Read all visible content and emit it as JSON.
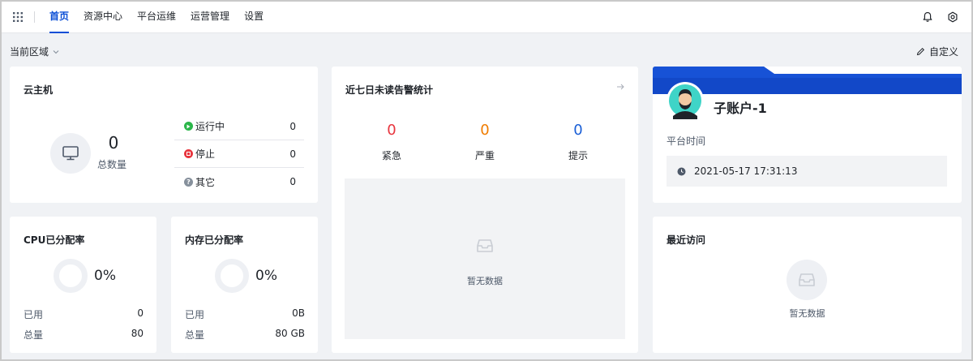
{
  "nav": {
    "items": [
      {
        "label": "首页",
        "active": true
      },
      {
        "label": "资源中心",
        "active": false
      },
      {
        "label": "平台运维",
        "active": false
      },
      {
        "label": "运营管理",
        "active": false
      },
      {
        "label": "设置",
        "active": false
      }
    ]
  },
  "icons": {
    "apps": "grid-icon",
    "notifications": "bell-icon",
    "settings": "gear-icon"
  },
  "toolbar": {
    "region_label": "当前区域",
    "customize_label": "自定义"
  },
  "host": {
    "title": "云主机",
    "total": "0",
    "total_label": "总数量",
    "statuses": [
      {
        "label": "运行中",
        "value": "0",
        "color": "#2bb64a"
      },
      {
        "label": "停止",
        "value": "0",
        "color": "#e8353e"
      },
      {
        "label": "其它",
        "value": "0",
        "color": "#86909c"
      }
    ]
  },
  "alerts": {
    "title": "近七日未读告警统计",
    "items": [
      {
        "label": "紧急",
        "value": "0",
        "color": "#e8353e"
      },
      {
        "label": "严重",
        "value": "0",
        "color": "#f07c00"
      },
      {
        "label": "提示",
        "value": "0",
        "color": "#1a5fd6"
      }
    ],
    "empty_text": "暂无数据"
  },
  "account": {
    "name": "子账户-1",
    "platform_time_label": "平台时间",
    "platform_time": "2021-05-17 17:31:13"
  },
  "cpu": {
    "title": "CPU已分配率",
    "percent": "0%",
    "used_label": "已用",
    "used_value": "0",
    "total_label": "总量",
    "total_value": "80"
  },
  "memory": {
    "title": "内存已分配率",
    "percent": "0%",
    "used_label": "已用",
    "used_value": "0B",
    "total_label": "总量",
    "total_value": "80 GB"
  },
  "recent": {
    "title": "最近访问",
    "empty_text": "暂无数据"
  },
  "colors": {
    "accent": "#0a4ed6",
    "banner": "#1248c8"
  }
}
